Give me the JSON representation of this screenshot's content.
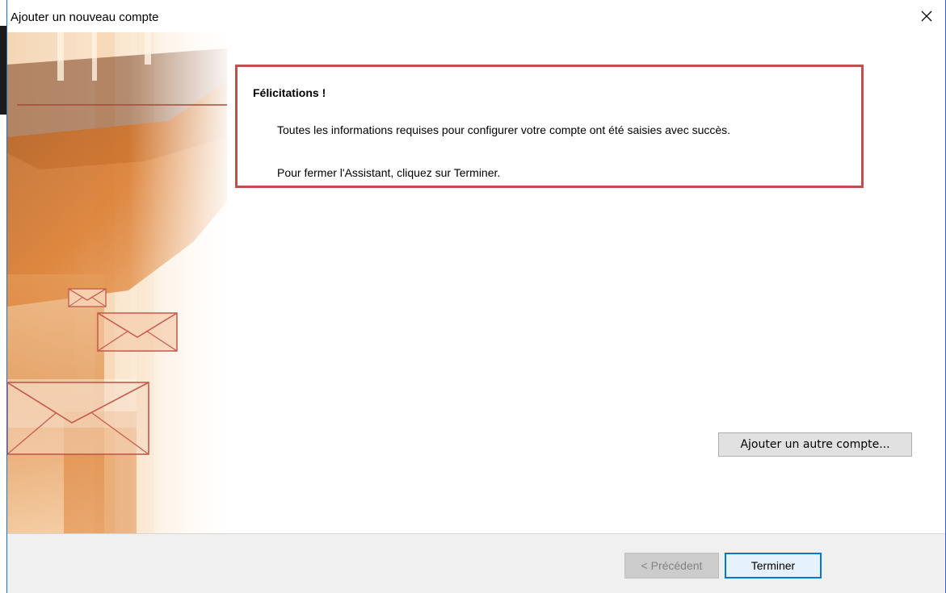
{
  "window": {
    "title": "Ajouter un nouveau compte",
    "close_icon": "close-icon"
  },
  "content": {
    "heading": "Félicitations !",
    "line1": "Toutes les informations requises pour configurer votre compte ont été saisies avec succès.",
    "line2": "Pour fermer l'Assistant, cliquez sur Terminer.",
    "add_account_label": "Ajouter un autre compte..."
  },
  "footer": {
    "previous_label": "< Précédent",
    "finish_label": "Terminer"
  },
  "colors": {
    "highlight_border": "#c0504d",
    "accent": "#0078d7",
    "art_orange": "#e07a1f"
  }
}
